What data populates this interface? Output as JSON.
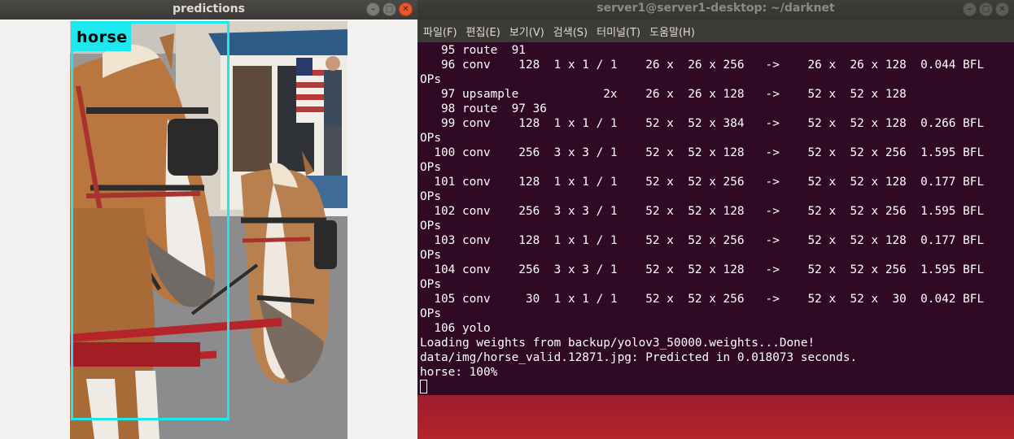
{
  "predictions_window": {
    "title": "predictions",
    "detection_label": "horse"
  },
  "terminal_window": {
    "title": "server1@server1-desktop: ~/darknet",
    "menu": [
      "파일(F)",
      "편집(E)",
      "보기(V)",
      "검색(S)",
      "터미널(T)",
      "도움말(H)"
    ],
    "lines": [
      "   95 route  91",
      "   96 conv    128  1 x 1 / 1    26 x  26 x 256   ->    26 x  26 x 128  0.044 BFL",
      "OPs",
      "   97 upsample            2x    26 x  26 x 128   ->    52 x  52 x 128",
      "   98 route  97 36",
      "   99 conv    128  1 x 1 / 1    52 x  52 x 384   ->    52 x  52 x 128  0.266 BFL",
      "OPs",
      "  100 conv    256  3 x 3 / 1    52 x  52 x 128   ->    52 x  52 x 256  1.595 BFL",
      "OPs",
      "  101 conv    128  1 x 1 / 1    52 x  52 x 256   ->    52 x  52 x 128  0.177 BFL",
      "OPs",
      "  102 conv    256  3 x 3 / 1    52 x  52 x 128   ->    52 x  52 x 256  1.595 BFL",
      "OPs",
      "  103 conv    128  1 x 1 / 1    52 x  52 x 256   ->    52 x  52 x 128  0.177 BFL",
      "OPs",
      "  104 conv    256  3 x 3 / 1    52 x  52 x 128   ->    52 x  52 x 256  1.595 BFL",
      "OPs",
      "  105 conv     30  1 x 1 / 1    52 x  52 x 256   ->    52 x  52 x  30  0.042 BFL",
      "OPs",
      "  106 yolo",
      "Loading weights from backup/yolov3_50000.weights...Done!",
      "data/img/horse_valid.12871.jpg: Predicted in 0.018073 seconds.",
      "horse: 100%"
    ]
  },
  "colors": {
    "terminal_bg": "#300a24",
    "bbox": "#1de8ee",
    "close_button": "#e9582c"
  }
}
